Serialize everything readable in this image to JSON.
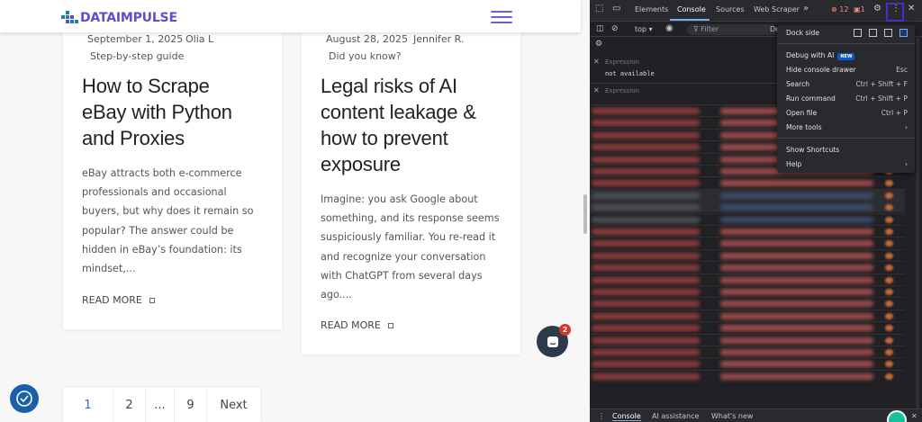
{
  "site": {
    "logo_text": "DATAIMPULSE",
    "accent": "#5b4fcf"
  },
  "posts": [
    {
      "date": "September 1, 2025",
      "author": "Olia L",
      "category": "Step-by-step guide",
      "title_lines": [
        "How to Scrape",
        "eBay with Python",
        "and Proxies"
      ],
      "excerpt_lines": [
        "eBay attracts both e-commerce",
        "professionals and occasional",
        "buyers, but why does it remain so",
        "popular? The answer could be",
        "hidden in eBay’s foundation: its",
        "mindset,..."
      ],
      "read_more": "READ MORE"
    },
    {
      "date": "August 28, 2025",
      "author": "Jennifer R.",
      "category": "Did you know?",
      "title_lines": [
        "Legal risks of AI",
        "content leakage &",
        "how to prevent",
        "exposure"
      ],
      "excerpt_lines": [
        "Imagine: you ask Google about",
        "something, and its response seems",
        "suspiciously familiar. You re-read it",
        "and recognize your conversation",
        "with ChatGPT from several days",
        "ago...."
      ],
      "read_more": "READ MORE"
    }
  ],
  "pagination": [
    "1",
    "2",
    "...",
    "9",
    "Next"
  ],
  "chat_badge": "2",
  "devtools": {
    "tabs": [
      "Elements",
      "Console",
      "Sources",
      "Web Scraper"
    ],
    "errors": "12",
    "warnings": "1",
    "context": "top",
    "filter_placeholder": "Filter",
    "expression_label": "Expression",
    "expression_value": "not available",
    "menu": {
      "dock_side": "Dock side",
      "debug_ai": "Debug with AI",
      "new_badge": "NEW",
      "items": [
        {
          "label": "Hide console drawer",
          "shortcut": "Esc"
        },
        {
          "label": "Search",
          "shortcut": "Ctrl + Shift + F"
        },
        {
          "label": "Run command",
          "shortcut": "Ctrl + Shift + P"
        },
        {
          "label": "Open file",
          "shortcut": "Ctrl + P"
        },
        {
          "label": "More tools",
          "shortcut": "›"
        }
      ],
      "show_shortcuts": "Show Shortcuts",
      "help": "Help",
      "help_arrow": "›"
    },
    "bottom_tabs": [
      "Console",
      "AI assistance",
      "What's new"
    ]
  }
}
